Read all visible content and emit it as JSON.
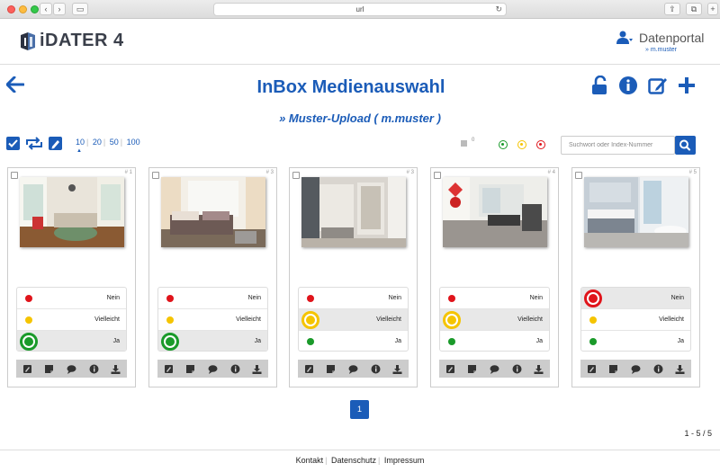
{
  "browser": {
    "url": "url"
  },
  "app": {
    "logo_text": "iDATER 4",
    "portal_title": "Datenportal",
    "portal_user": "» m.muster"
  },
  "page": {
    "title": "InBox Medienauswahl",
    "subtitle": "» Muster-Upload ( m.muster )"
  },
  "toolbar": {
    "page_sizes": [
      "10",
      "20",
      "50",
      "100"
    ],
    "active_page_size": "10",
    "note_count": "0",
    "search_placeholder": "Suchwort oder Index-Nummer"
  },
  "colors": {
    "brand": "#1b5cb8",
    "no": "#e0141b",
    "maybe": "#f5c400",
    "yes": "#1a9a2a"
  },
  "rating_labels": {
    "no": "Nein",
    "maybe": "Vielleicht",
    "yes": "Ja"
  },
  "cards": [
    {
      "index": "# 1",
      "selected": "yes",
      "image": "living-room"
    },
    {
      "index": "# 3",
      "selected": "yes",
      "image": "bedroom"
    },
    {
      "index": "# 3",
      "selected": "maybe",
      "image": "hallway"
    },
    {
      "index": "# 4",
      "selected": "maybe",
      "image": "dining-room"
    },
    {
      "index": "# 5",
      "selected": "no",
      "image": "bathroom"
    }
  ],
  "action_icons": [
    "pencil-icon",
    "note-icon",
    "comment-icon",
    "info-icon",
    "download-icon"
  ],
  "pagination": {
    "current": "1",
    "result_count": "1 - 5 / 5"
  },
  "footer": {
    "links": [
      "Kontakt",
      "Datenschutz",
      "Impressum"
    ]
  }
}
